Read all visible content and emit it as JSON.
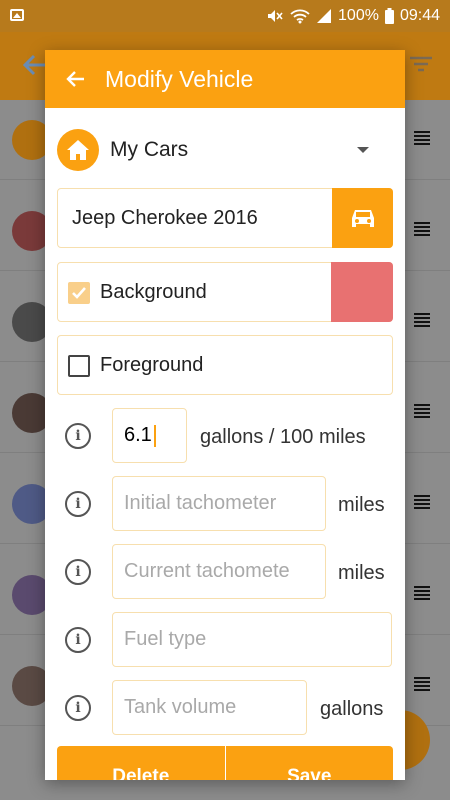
{
  "status_bar": {
    "battery": "100%",
    "time": "09:44"
  },
  "background_list": {
    "avatar_colors": [
      "#b07010",
      "#7a3a3a",
      "#4a4a4a",
      "#4a3a35",
      "#4f5a86",
      "#5a4a6e",
      "#5a4a44"
    ]
  },
  "dialog": {
    "title": "Modify Vehicle",
    "group": "My Cars",
    "vehicle_name": "Jeep Cherokee 2016",
    "background_label": "Background",
    "background_checked": true,
    "background_color": "#e87171",
    "foreground_label": "Foreground",
    "foreground_checked": false,
    "consumption_value": "6.1",
    "consumption_unit": "gallons / 100 miles",
    "initial_tachometer_placeholder": "Initial tachometer",
    "initial_tachometer_unit": "miles",
    "current_tachometer_placeholder": "Current tachomete",
    "current_tachometer_unit": "miles",
    "fuel_type_placeholder": "Fuel type",
    "tank_volume_placeholder": "Tank volume",
    "tank_volume_unit": "gallons",
    "delete_label": "Delete",
    "save_label": "Save"
  },
  "colors": {
    "accent": "#fba111",
    "field_border": "#f7dfae"
  },
  "icons": {
    "back": "arrow-left-icon",
    "home": "home-icon",
    "car": "car-icon",
    "info": "info-icon",
    "check": "check-icon"
  }
}
